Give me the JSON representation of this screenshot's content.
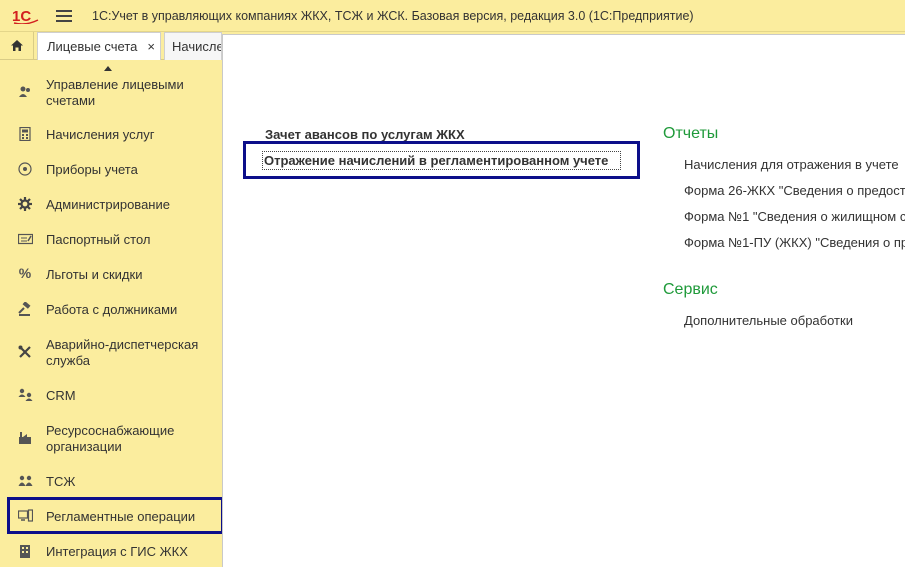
{
  "app": {
    "logo_text": "1С",
    "title": "1С:Учет в управляющих компаниях ЖКХ, ТСЖ и ЖСК. Базовая версия, редакция 3.0  (1С:Предприятие)"
  },
  "tabs": [
    {
      "label": "Лицевые счета",
      "close": "×"
    },
    {
      "label": "Начисле"
    }
  ],
  "sidebar": {
    "items": [
      {
        "label": "Управление лицевыми счетами",
        "icon": "users-icon"
      },
      {
        "label": "Начисления услуг",
        "icon": "calculator-icon"
      },
      {
        "label": "Приборы учета",
        "icon": "meter-icon"
      },
      {
        "label": "Администрирование",
        "icon": "gear-icon"
      },
      {
        "label": "Паспортный стол",
        "icon": "passport-icon"
      },
      {
        "label": "Льготы и скидки",
        "icon": "percent-icon"
      },
      {
        "label": "Работа с должниками",
        "icon": "gavel-icon"
      },
      {
        "label": "Аварийно-диспетчерская служба",
        "icon": "tools-icon"
      },
      {
        "label": "CRM",
        "icon": "crm-icon"
      },
      {
        "label": "Ресурсоснабжающие организации",
        "icon": "factory-icon"
      },
      {
        "label": "ТСЖ",
        "icon": "people-icon"
      },
      {
        "label": "Регламентные операции",
        "icon": "operations-icon"
      },
      {
        "label": "Интеграция с ГИС ЖКХ",
        "icon": "building-icon"
      }
    ]
  },
  "content": {
    "left_links": [
      "Зачет авансов по услугам ЖКХ",
      "Отражение начислений в регламентированном учете"
    ],
    "reports_title": "Отчеты",
    "reports": [
      "Начисления для отражения в учете",
      "Форма 26-ЖКХ \"Сведения о предост",
      "Форма №1 \"Сведения о жилищном с",
      "Форма №1-ПУ (ЖКХ) \"Сведения о пр"
    ],
    "service_title": "Сервис",
    "service": [
      "Дополнительные обработки"
    ]
  },
  "colors": {
    "panel_yellow": "#fbed9e",
    "section_green": "#1f9a3a",
    "highlight_navy": "#0c0f8a",
    "logo_red": "#d21f1f"
  }
}
